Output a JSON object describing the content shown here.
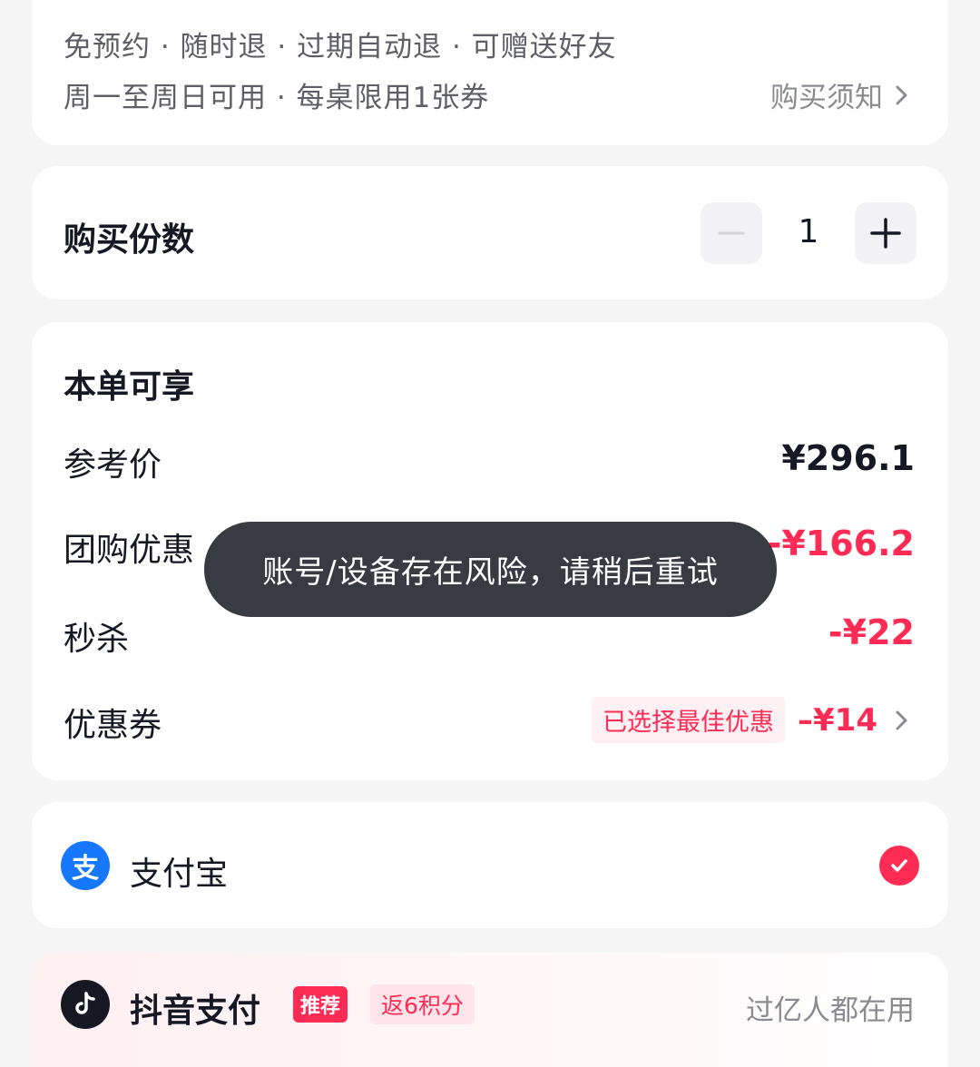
{
  "info": {
    "line1": "免预约 · 随时退 · 过期自动退 · 可赠送好友",
    "line2": "周一至周日可用 · 每桌限用1张券",
    "notice_label": "购买须知"
  },
  "quantity": {
    "title": "购买份数",
    "value": "1"
  },
  "discounts": {
    "title": "本单可享",
    "reference_label": "参考价",
    "reference_value": "¥296.1",
    "group_label": "团购优惠",
    "group_value": "-¥166.2",
    "seckill_label": "秒杀",
    "seckill_value": "-¥22",
    "coupon_label": "优惠券",
    "coupon_badge": "已选择最佳优惠",
    "coupon_value": "–¥14"
  },
  "payment": {
    "alipay_name": "支付宝",
    "alipay_icon_glyph": "支",
    "alipay_selected": true,
    "douyin_name": "抖音支付",
    "douyin_tag": "推荐",
    "douyin_points": "返6积分",
    "douyin_note": "过亿人都在用"
  },
  "toast": {
    "message": "账号/设备存在风险，请稍后重试"
  },
  "colors": {
    "accent": "#fe2c55",
    "alipay_blue": "#1677ff",
    "text_primary": "#161823",
    "text_secondary": "#8a8b91",
    "background": "#f5f5f5"
  },
  "icons": {
    "notice_chevron": "chevron-right-icon",
    "minus": "minus-icon",
    "plus": "plus-icon",
    "coupon_chevron": "chevron-right-icon",
    "alipay": "alipay-icon",
    "check": "check-icon",
    "douyin": "douyin-icon"
  }
}
